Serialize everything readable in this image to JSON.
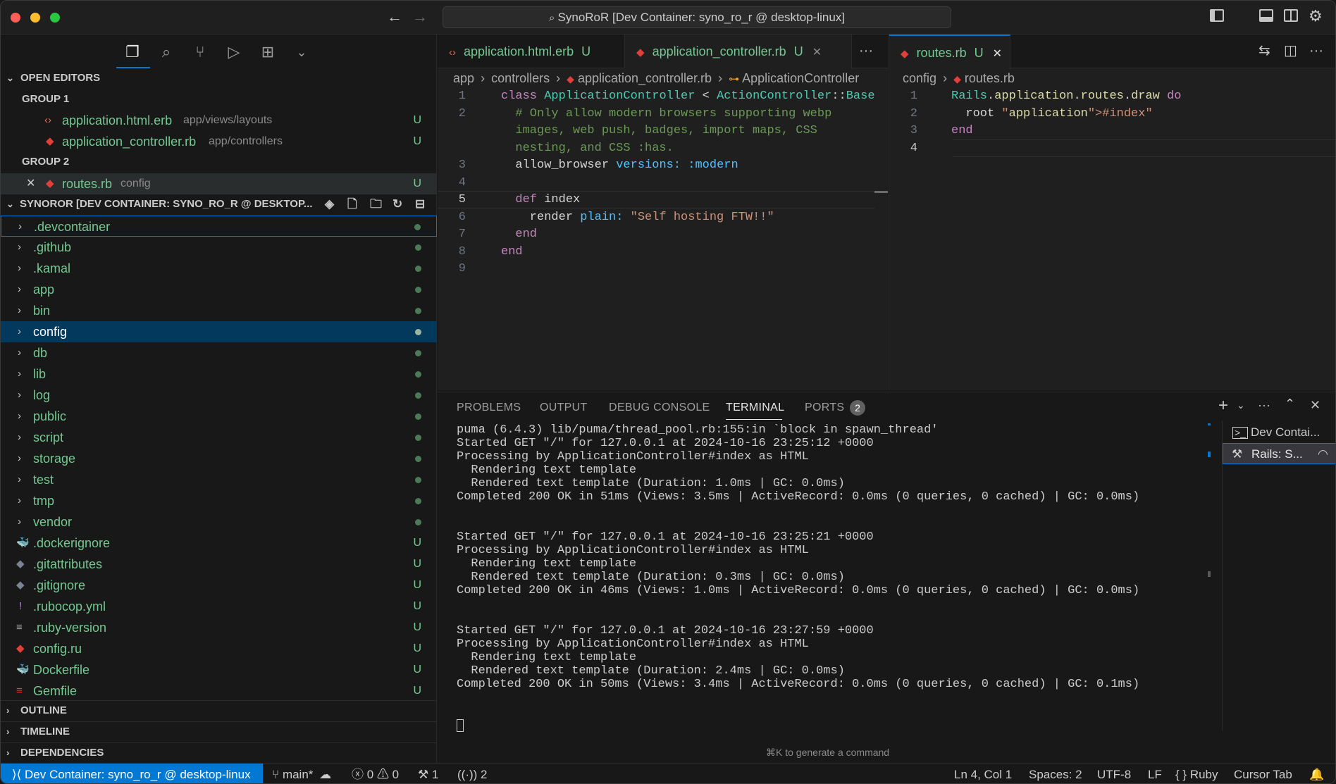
{
  "window": {
    "title": "SynoRoR [Dev Container: syno_ro_r @ desktop-linux]"
  },
  "sidebar": {
    "open_editors_label": "OPEN EDITORS",
    "group1_label": "GROUP 1",
    "group2_label": "GROUP 2",
    "open_editors": [
      {
        "name": "application.html.erb",
        "path": "app/views/layouts",
        "badge": "U"
      },
      {
        "name": "application_controller.rb",
        "path": "app/controllers",
        "badge": "U"
      },
      {
        "name": "routes.rb",
        "path": "config",
        "badge": "U"
      }
    ],
    "explorer_title": "SYNOROR [DEV CONTAINER: SYNO_RO_R @ DESKTOP...",
    "folders": [
      ".devcontainer",
      ".github",
      ".kamal",
      "app",
      "bin",
      "config",
      "db",
      "lib",
      "log",
      "public",
      "script",
      "storage",
      "test",
      "tmp",
      "vendor"
    ],
    "files": [
      {
        "name": ".dockerignore",
        "badge": "U",
        "icon": "docker-icon"
      },
      {
        "name": ".gitattributes",
        "badge": "U",
        "icon": "git-icon"
      },
      {
        "name": ".gitignore",
        "badge": "U",
        "icon": "git-icon"
      },
      {
        "name": ".rubocop.yml",
        "badge": "U",
        "icon": "yaml-icon"
      },
      {
        "name": ".ruby-version",
        "badge": "U",
        "icon": "text-icon"
      },
      {
        "name": "config.ru",
        "badge": "U",
        "icon": "ruby-icon"
      },
      {
        "name": "Dockerfile",
        "badge": "U",
        "icon": "docker-icon"
      },
      {
        "name": "Gemfile",
        "badge": "U",
        "icon": "ruby-icon"
      }
    ],
    "outline_label": "OUTLINE",
    "timeline_label": "TIMELINE",
    "dependencies_label": "DEPENDENCIES"
  },
  "editor_left": {
    "tabs": [
      {
        "label": "application.html.erb",
        "badge": "U"
      },
      {
        "label": "application_controller.rb",
        "badge": "U"
      }
    ],
    "more": "···",
    "breadcrumb": [
      "app",
      "controllers",
      "application_controller.rb",
      "ApplicationController"
    ],
    "line_numbers": [
      "1",
      "2",
      "",
      "",
      "3",
      "4",
      "5",
      "6",
      "7",
      "8",
      "9"
    ],
    "lines": [
      "class ApplicationController < ActionController::Base",
      "  # Only allow modern browsers supporting webp",
      "  images, web push, badges, import maps, CSS",
      "  nesting, and CSS :has.",
      "  allow_browser versions: :modern",
      "",
      "  def index",
      "    render plain: \"Self hosting FTW!!\"",
      "  end",
      "end",
      ""
    ]
  },
  "editor_right": {
    "tab": {
      "label": "routes.rb",
      "badge": "U"
    },
    "breadcrumb": [
      "config",
      "routes.rb"
    ],
    "line_numbers": [
      "1",
      "2",
      "3",
      "4"
    ],
    "lines": [
      "Rails.application.routes.draw do",
      "  root \"application#index\"",
      "end",
      ""
    ]
  },
  "panel": {
    "tabs": [
      "PROBLEMS",
      "OUTPUT",
      "DEBUG CONSOLE",
      "TERMINAL",
      "PORTS"
    ],
    "ports_count": "2",
    "terminal_lines": [
      "puma (6.4.3) lib/puma/thread_pool.rb:155:in `block in spawn_thread'",
      "Started GET \"/\" for 127.0.0.1 at 2024-10-16 23:25:12 +0000",
      "Processing by ApplicationController#index as HTML",
      "  Rendering text template",
      "  Rendered text template (Duration: 1.0ms | GC: 0.0ms)",
      "Completed 200 OK in 51ms (Views: 3.5ms | ActiveRecord: 0.0ms (0 queries, 0 cached) | GC: 0.0ms)",
      "",
      "",
      "Started GET \"/\" for 127.0.0.1 at 2024-10-16 23:25:21 +0000",
      "Processing by ApplicationController#index as HTML",
      "  Rendering text template",
      "  Rendered text template (Duration: 0.3ms | GC: 0.0ms)",
      "Completed 200 OK in 46ms (Views: 1.0ms | ActiveRecord: 0.0ms (0 queries, 0 cached) | GC: 0.0ms)",
      "",
      "",
      "Started GET \"/\" for 127.0.0.1 at 2024-10-16 23:27:59 +0000",
      "Processing by ApplicationController#index as HTML",
      "  Rendering text template",
      "  Rendered text template (Duration: 2.4ms | GC: 0.0ms)",
      "Completed 200 OK in 50ms (Views: 3.4ms | ActiveRecord: 0.0ms (0 queries, 0 cached) | GC: 0.1ms)"
    ],
    "hint": "⌘K to generate a command",
    "terminals": [
      {
        "label": "Dev Contai..."
      },
      {
        "label": "Rails: S..."
      }
    ]
  },
  "status": {
    "remote": "Dev Container: syno_ro_r @ desktop-linux",
    "branch": "main*",
    "errors": "0",
    "warnings": "0",
    "ports_fwd": "1",
    "radio": "2",
    "position": "Ln 4, Col 1",
    "spaces": "Spaces: 2",
    "encoding": "UTF-8",
    "eol": "LF",
    "language": "Ruby",
    "cursor": "Cursor Tab"
  },
  "colors": {
    "accent": "#0078d4",
    "git_untracked": "#73c991",
    "ruby": "#e0403a"
  }
}
